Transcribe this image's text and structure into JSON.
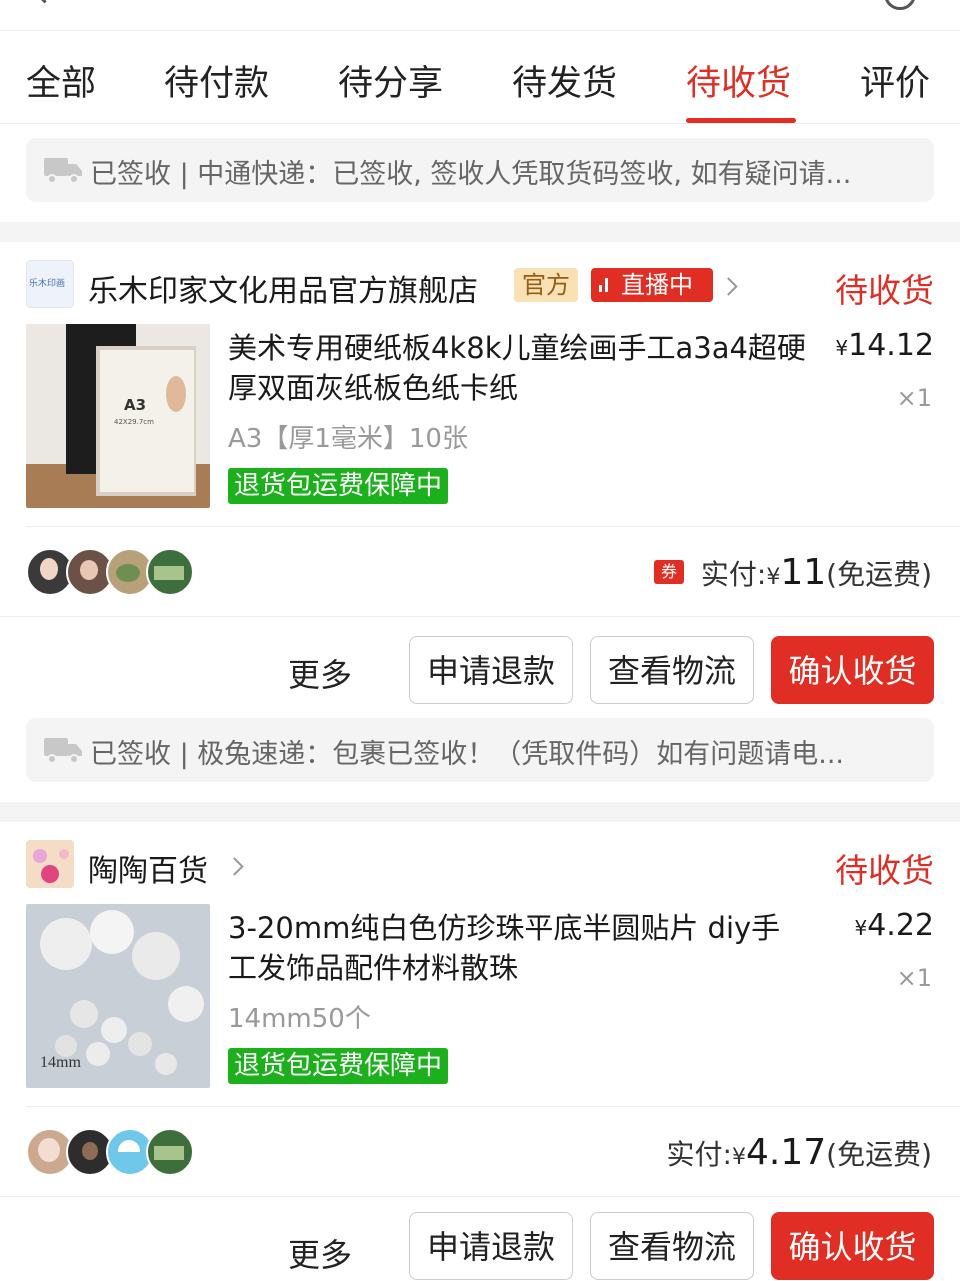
{
  "tabs": [
    {
      "label": "全部"
    },
    {
      "label": "待付款"
    },
    {
      "label": "待分享"
    },
    {
      "label": "待发货"
    },
    {
      "label": "待收货"
    },
    {
      "label": "评价"
    }
  ],
  "active_tab": "待收货",
  "top_logistics": {
    "text": "已签收 | 中通快递：已签收, 签收人凭取货码签收, 如有疑问请..."
  },
  "orders": [
    {
      "shop_name": "乐木印家文化用品官方旗舰店",
      "shop_logo_text": "乐木印画",
      "badge_official": "官方",
      "badge_live": "直播中",
      "status": "待收货",
      "product_title": "美术专用硬纸板4k8k儿童绘画手工a3a4超硬厚双面灰纸板色纸卡纸",
      "thumb_text": "A3",
      "thumb_subtext": "42X29.7cm",
      "currency": "¥",
      "price": "14.12",
      "qty": "×1",
      "spec": "A3【厚1毫米】10张",
      "guarantee": "退货包运费保障中",
      "coupon": "券",
      "paid_label": "实付:",
      "paid_amount": "11",
      "shipping_note": "(免运费)",
      "more_label": "更多",
      "refund_label": "申请退款",
      "logistics_label": "查看物流",
      "confirm_label": "确认收货",
      "logistics_text": "已签收 | 极兔速递：包裹已签收！（凭取件码）如有问题请电..."
    },
    {
      "shop_name": "陶陶百货",
      "status": "待收货",
      "product_title": "3-20mm纯白色仿珍珠平底半圆贴片 diy手工发饰品配件材料散珠",
      "thumb_text": "14mm",
      "currency": "¥",
      "price": "4.22",
      "qty": "×1",
      "spec": "14mm50个",
      "guarantee": "退货包运费保障中",
      "paid_label": "实付:",
      "paid_amount": "4.17",
      "shipping_note": "(免运费)",
      "more_label": "更多",
      "refund_label": "申请退款",
      "logistics_label": "查看物流",
      "confirm_label": "确认收货"
    }
  ],
  "colors": {
    "accent": "#e02e24",
    "guarantee_green": "#1cb01c",
    "official_bg": "#f7e1b5"
  }
}
